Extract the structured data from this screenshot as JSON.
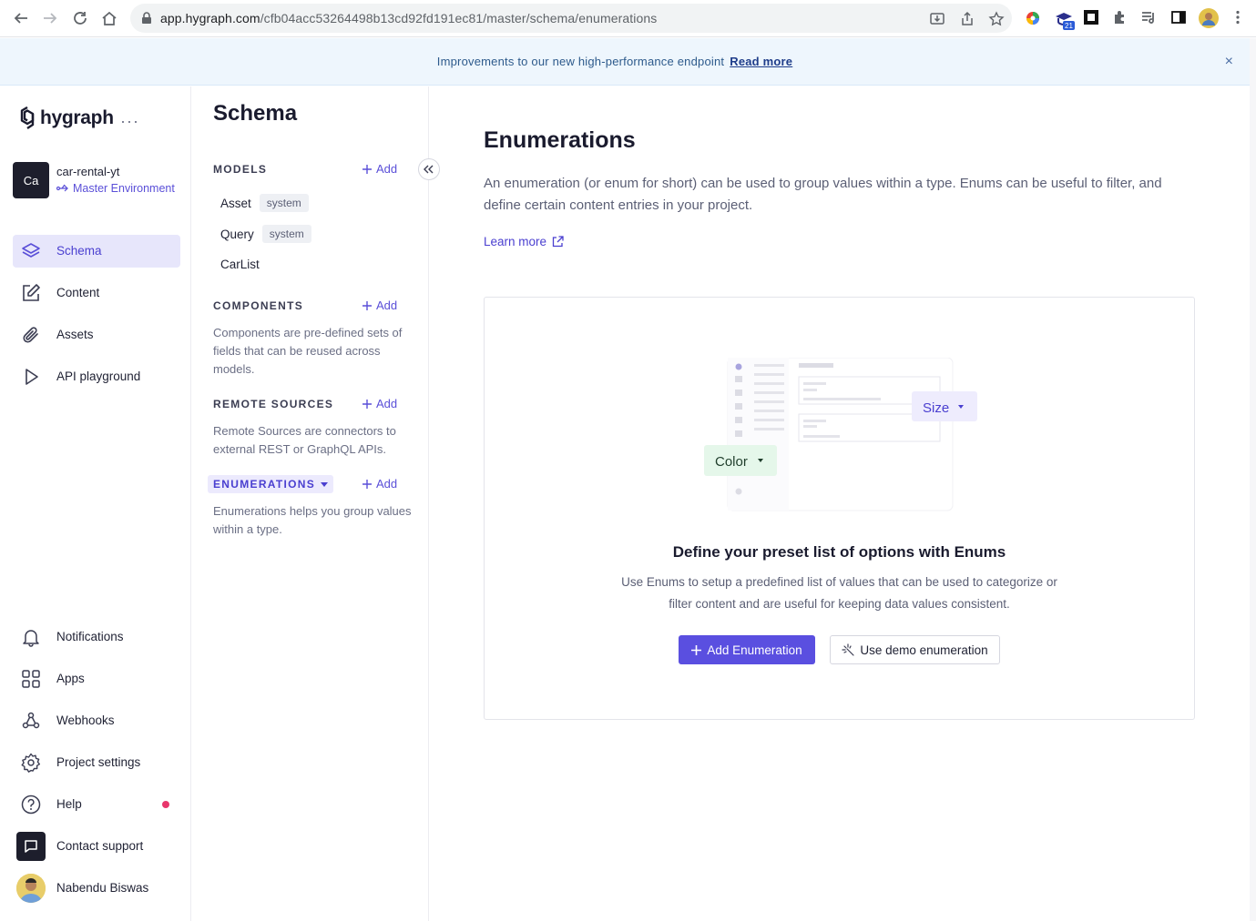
{
  "browser": {
    "url_host": "app.hygraph.com",
    "url_path": "/cfb04acc53264498b13cd92fd191ec81/master/schema/enumerations",
    "ext_badge": "21"
  },
  "banner": {
    "text": "Improvements to our new high-performance endpoint",
    "link": "Read more",
    "close": "×"
  },
  "leftnav": {
    "logo": "hygraph",
    "menu_dots": "···",
    "project": {
      "initials": "Ca",
      "name": "car-rental-yt",
      "environment": "Master Environment"
    },
    "items": [
      {
        "label": "Schema",
        "icon": "layers-icon"
      },
      {
        "label": "Content",
        "icon": "edit-icon"
      },
      {
        "label": "Assets",
        "icon": "paperclip-icon"
      },
      {
        "label": "API playground",
        "icon": "play-icon"
      }
    ],
    "bottom_items": [
      {
        "label": "Notifications",
        "icon": "bell-icon"
      },
      {
        "label": "Apps",
        "icon": "apps-icon"
      },
      {
        "label": "Webhooks",
        "icon": "webhook-icon"
      },
      {
        "label": "Project settings",
        "icon": "gear-icon"
      },
      {
        "label": "Help",
        "icon": "help-icon"
      },
      {
        "label": "Contact support",
        "icon": "chat-icon"
      },
      {
        "label": "Nabendu Biswas",
        "icon": "avatar"
      }
    ],
    "accent_color": "#5a4fd8",
    "help_dot_color": "#e8366c"
  },
  "schema_sidebar": {
    "title": "Schema",
    "add_label": "Add",
    "models": {
      "heading": "MODELS",
      "items": [
        {
          "name": "Asset",
          "tag": "system"
        },
        {
          "name": "Query",
          "tag": "system"
        },
        {
          "name": "CarList",
          "tag": ""
        }
      ]
    },
    "components": {
      "heading": "COMPONENTS",
      "description": "Components are pre-defined sets of fields that can be reused across models."
    },
    "remote_sources": {
      "heading": "REMOTE SOURCES",
      "description": "Remote Sources are connectors to external REST or GraphQL APIs."
    },
    "enumerations": {
      "heading": "ENUMERATIONS",
      "description": "Enumerations helps you group values within a type."
    }
  },
  "main": {
    "title": "Enumerations",
    "description": "An enumeration (or enum for short) can be used to group values within a type. Enums can be useful to filter, and define certain content entries in your project.",
    "learn_more": "Learn more",
    "card": {
      "illustration_chip_size": "Size",
      "illustration_chip_color": "Color",
      "title": "Define your preset list of options with Enums",
      "description": "Use Enums to setup a predefined list of values that can be used to categorize or filter content and are useful for keeping data values consistent.",
      "primary_button": "Add Enumeration",
      "secondary_button": "Use demo enumeration"
    },
    "primary_color": "#5a4fe0"
  }
}
